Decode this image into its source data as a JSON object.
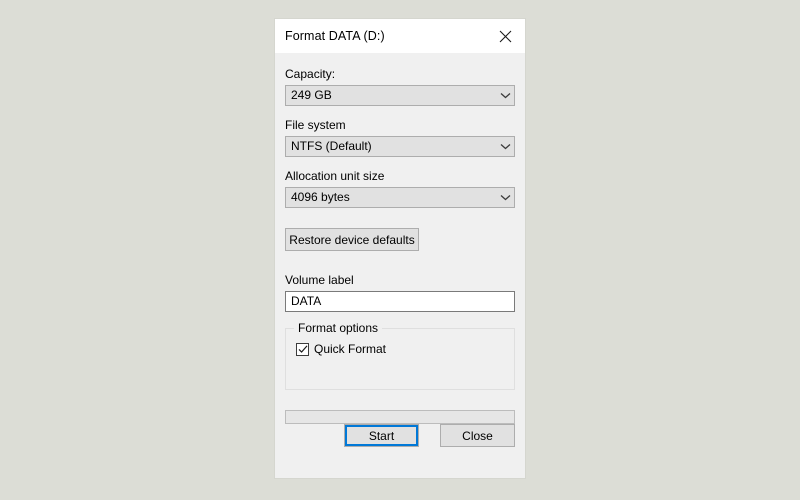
{
  "window": {
    "title": "Format DATA (D:)",
    "close_icon": "close-icon"
  },
  "form": {
    "capacity": {
      "label": "Capacity:",
      "value": "249 GB"
    },
    "file_system": {
      "label": "File system",
      "value": "NTFS (Default)"
    },
    "allocation_unit_size": {
      "label": "Allocation unit size",
      "value": "4096 bytes"
    },
    "restore_defaults_label": "Restore device defaults",
    "volume_label": {
      "label": "Volume label",
      "value": "DATA"
    },
    "format_options": {
      "legend": "Format options",
      "quick_format": {
        "label": "Quick Format",
        "checked": true
      }
    },
    "progress": {
      "percent": 0
    }
  },
  "footer": {
    "start_label": "Start",
    "close_label": "Close"
  },
  "colors": {
    "accent": "#0078d7",
    "page_background": "#dcddd6",
    "dialog_background": "#f0f0f0",
    "titlebar_background": "#ffffff"
  }
}
